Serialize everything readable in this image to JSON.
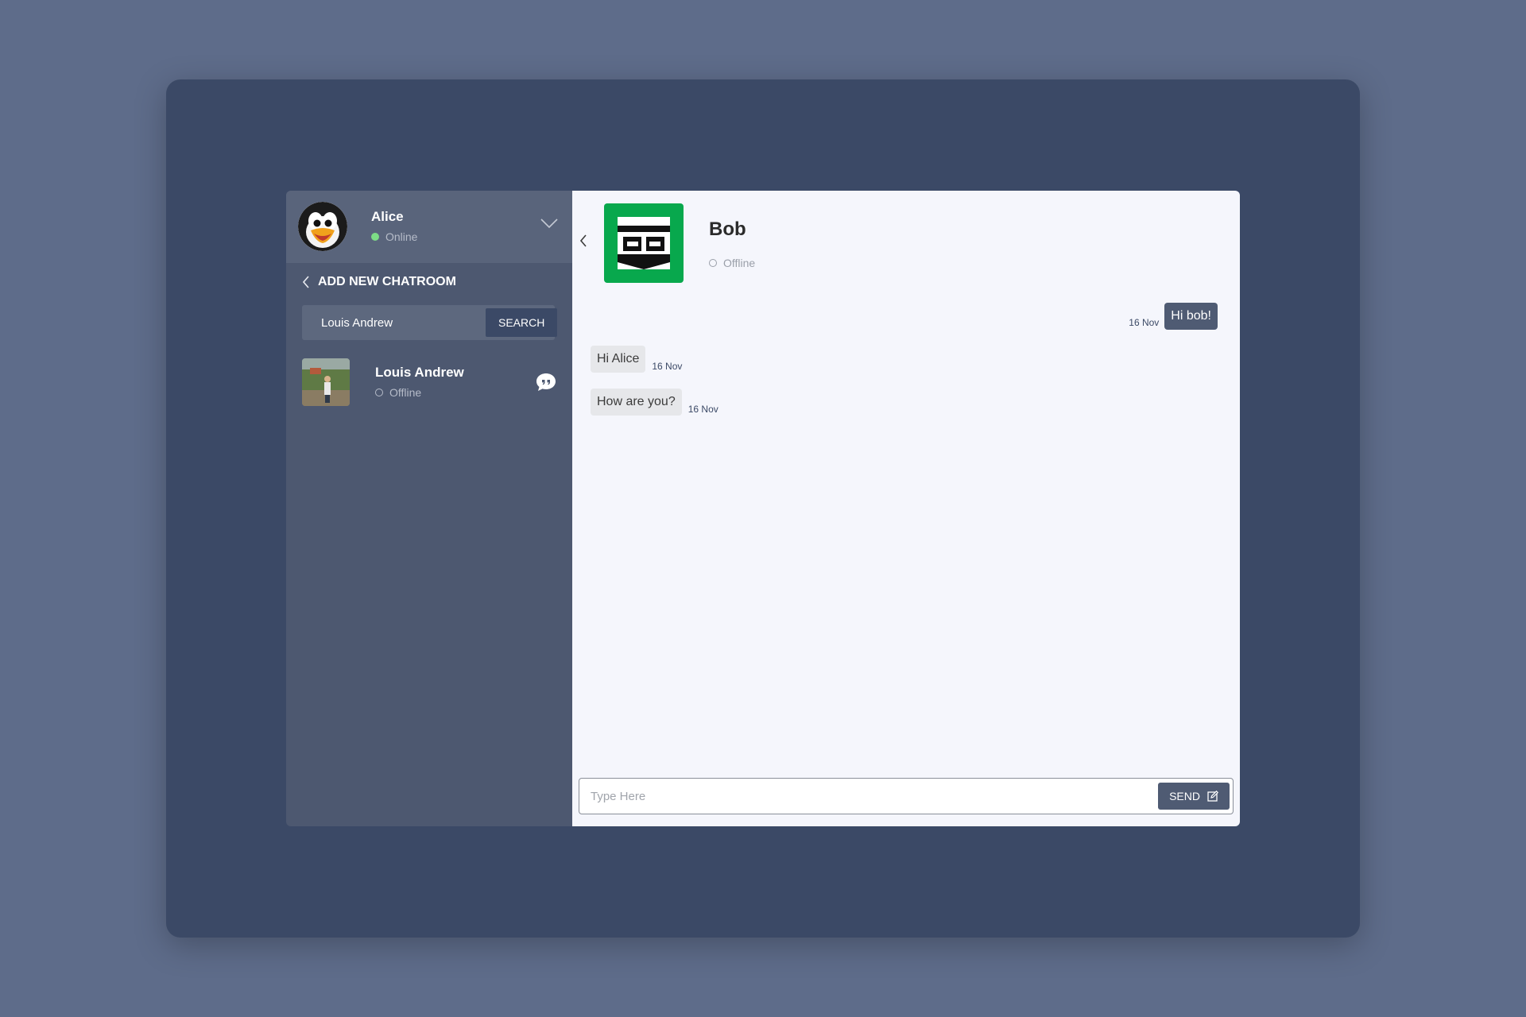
{
  "current_user": {
    "name": "Alice",
    "status": "Online",
    "avatar": "penguin-avatar"
  },
  "sidebar": {
    "section_title": "ADD NEW CHATROOM",
    "search": {
      "value": "Louis Andrew",
      "button_label": "SEARCH"
    },
    "results": [
      {
        "name": "Louis Andrew",
        "status": "Offline"
      }
    ]
  },
  "chat": {
    "contact": {
      "name": "Bob",
      "status": "Offline",
      "avatar": "identicon-avatar"
    },
    "messages": [
      {
        "direction": "out",
        "text": "Hi bob!",
        "time": "16 Nov"
      },
      {
        "direction": "in",
        "text": "Hi Alice",
        "time": "16 Nov"
      },
      {
        "direction": "in",
        "text": "How are you?",
        "time": "16 Nov"
      }
    ],
    "composer": {
      "placeholder": "Type Here",
      "send_label": "SEND"
    }
  },
  "colors": {
    "background": "#5e6c8a",
    "frame": "#3b4966",
    "sidebar": "#4d5870",
    "chat_bg": "#f5f6fc",
    "online": "#7ddc86",
    "outgoing_bubble": "#4f5b73",
    "incoming_bubble": "#e6e7ea",
    "bob_avatar": "#08a84d"
  }
}
